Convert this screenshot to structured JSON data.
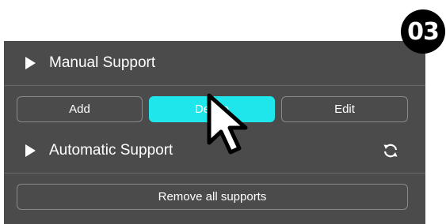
{
  "step_badge": "03",
  "manual_support": {
    "title": "Manual Support",
    "buttons": {
      "add": "Add",
      "delete": "Delete",
      "edit": "Edit"
    }
  },
  "automatic_support": {
    "title": "Automatic Support",
    "remove_all": "Remove all supports"
  },
  "icons": {
    "collapse_manual": "triangle-right-icon",
    "collapse_auto": "triangle-right-icon",
    "refresh": "refresh-icon",
    "cursor": "mouse-pointer-icon"
  },
  "colors": {
    "panel": "#4b4b4b",
    "active_button": "#1ee6ea",
    "text": "#ffffff"
  }
}
